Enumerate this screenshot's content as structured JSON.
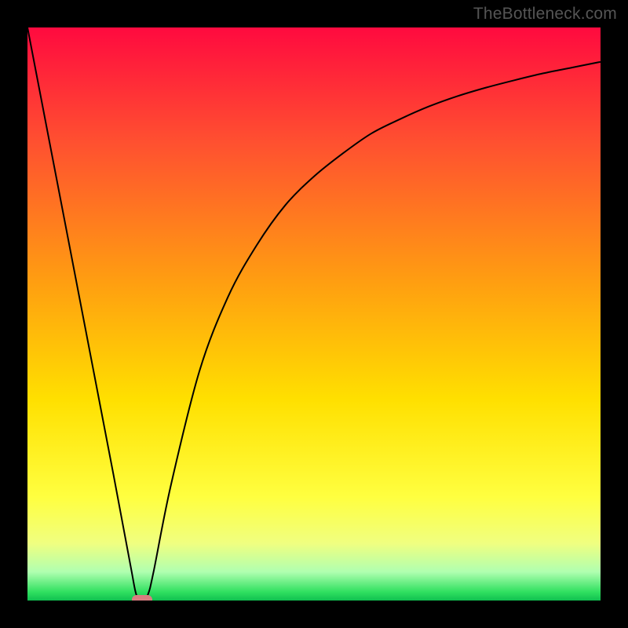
{
  "watermark": "TheBottleneck.com",
  "chart_data": {
    "type": "line",
    "title": "",
    "xlabel": "",
    "ylabel": "",
    "xlim": [
      0,
      100
    ],
    "ylim": [
      0,
      100
    ],
    "grid": false,
    "legend": false,
    "series": [
      {
        "name": "bottleneck-curve",
        "x": [
          0,
          5,
          10,
          15,
          18,
          19,
          20,
          21,
          22,
          25,
          30,
          35,
          40,
          45,
          50,
          55,
          60,
          65,
          70,
          75,
          80,
          85,
          90,
          95,
          100
        ],
        "y": [
          100,
          74,
          48,
          22,
          6,
          1,
          0,
          1,
          5,
          20,
          40,
          53,
          62,
          69,
          74,
          78,
          81.5,
          84,
          86.2,
          88,
          89.5,
          90.8,
          92,
          93,
          94
        ]
      }
    ],
    "marker": {
      "name": "optimal-point",
      "x": 20,
      "y": 0,
      "color": "#d97d80",
      "shape": "rounded-rect"
    },
    "background_gradient": [
      {
        "stop": 0.0,
        "color": "#ff0a3f"
      },
      {
        "stop": 0.2,
        "color": "#ff5030"
      },
      {
        "stop": 0.45,
        "color": "#ffa010"
      },
      {
        "stop": 0.65,
        "color": "#ffe000"
      },
      {
        "stop": 0.82,
        "color": "#ffff40"
      },
      {
        "stop": 0.9,
        "color": "#f0ff80"
      },
      {
        "stop": 0.95,
        "color": "#b0ffb0"
      },
      {
        "stop": 0.985,
        "color": "#30e060"
      },
      {
        "stop": 1.0,
        "color": "#10c050"
      }
    ]
  }
}
